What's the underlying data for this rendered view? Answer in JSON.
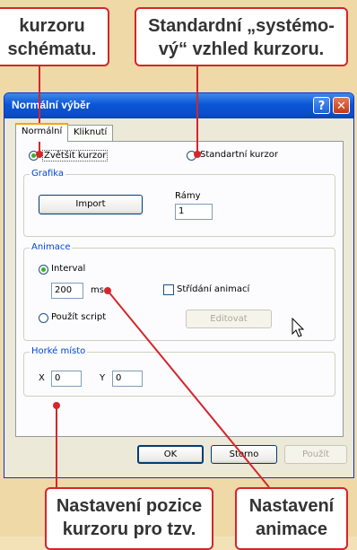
{
  "callouts": {
    "top_left": [
      "kurzoru",
      "schématu."
    ],
    "top_right": [
      "Standardní „systémo-",
      "vý“ vzhled kurzoru."
    ],
    "bottom_left": [
      "Nastavení pozice",
      "kurzoru pro tzv."
    ],
    "bottom_right": [
      "Nastavení",
      "animace"
    ]
  },
  "dialog": {
    "title": "Normální výběr",
    "help_label": "?",
    "close_label": "✕",
    "tabs": [
      {
        "label": "Normální"
      },
      {
        "label": "Kliknutí"
      }
    ],
    "enlarge_cursor_label": "Zvětšit kurzor",
    "standard_cursor_label": "Standartní kurzor",
    "graphics": {
      "title": "Grafika",
      "import_label": "Import",
      "frames_label": "Rámy",
      "frames_value": "1"
    },
    "animation": {
      "title": "Animace",
      "interval_label": "Interval",
      "interval_value": "200",
      "interval_unit": "ms",
      "alternate_label": "Střídání animací",
      "script_label": "Použít script",
      "edit_label": "Editovat"
    },
    "hotspot": {
      "title": "Horké místo",
      "x_label": "X",
      "x_value": "0",
      "y_label": "Y",
      "y_value": "0"
    },
    "ok_label": "OK",
    "cancel_label": "Storno",
    "apply_label": "Použít"
  },
  "colors": {
    "callout_border": "#d4262b",
    "accent_line": "#d4262b",
    "background": "#f3e2b8"
  }
}
